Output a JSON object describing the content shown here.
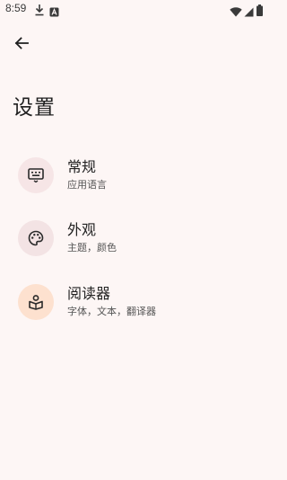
{
  "status_bar": {
    "time": "8:59",
    "icons": [
      "download-icon",
      "a-badge-icon",
      "wifi-icon",
      "signal-icon",
      "battery-icon"
    ]
  },
  "header": {
    "back_icon": "arrow-left-icon",
    "title": "设置"
  },
  "settings": {
    "items": [
      {
        "title": "常规",
        "subtitle": "应用语言",
        "icon": "keyboard-icon",
        "icon_bg": "#f6e5e6"
      },
      {
        "title": "外观",
        "subtitle": "主题，颜色",
        "icon": "palette-icon",
        "icon_bg": "#f3e3e4"
      },
      {
        "title": "阅读器",
        "subtitle": "字体，文本，翻译器",
        "icon": "book-reader-icon",
        "icon_bg": "#fde1cf"
      }
    ]
  },
  "colors": {
    "background": "#fdf6f5",
    "text_primary": "#222222",
    "text_secondary": "#555555"
  }
}
